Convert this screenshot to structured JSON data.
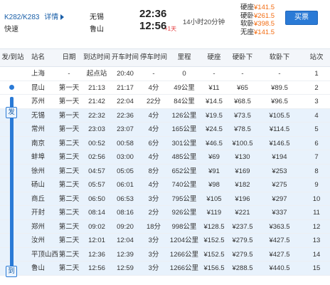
{
  "header": {
    "train_number": "K282/K283",
    "detail_link": "详情",
    "train_type": "快速",
    "from_station": "无锡",
    "to_station": "鲁山",
    "depart_time": "22:36",
    "arrive_time": "12:56",
    "next_day_mark": "+1天",
    "duration": "14小时20分钟",
    "prices": [
      {
        "name": "硬座",
        "value": "¥141.5"
      },
      {
        "name": "硬卧",
        "value": "¥261.5"
      },
      {
        "name": "软卧",
        "value": "¥398.5"
      },
      {
        "name": "无座",
        "value": "¥141.5"
      }
    ],
    "buy_label": "买票"
  },
  "table": {
    "columns": [
      "发/到站",
      "站名",
      "日期",
      "到达时间",
      "开车时间",
      "停车时间",
      "里程",
      "硬座",
      "硬卧下",
      "软卧下",
      "站次"
    ],
    "track_start": "发",
    "track_end": "到",
    "rows": [
      {
        "station": "上海",
        "date": "-",
        "arrive": "起点站",
        "depart": "20:40",
        "stop": "-",
        "mileage": "0",
        "hard_seat": "-",
        "hard_sleeper": "-",
        "soft_sleeper": "-",
        "no": "1"
      },
      {
        "station": "昆山",
        "date": "第一天",
        "arrive": "21:13",
        "depart": "21:17",
        "stop": "4分",
        "mileage": "49公里",
        "hard_seat": "¥11",
        "hard_sleeper": "¥65",
        "soft_sleeper": "¥89.5",
        "no": "2"
      },
      {
        "station": "苏州",
        "date": "第一天",
        "arrive": "21:42",
        "depart": "22:04",
        "stop": "22分",
        "mileage": "84公里",
        "hard_seat": "¥14.5",
        "hard_sleeper": "¥68.5",
        "soft_sleeper": "¥96.5",
        "no": "3"
      },
      {
        "station": "无锡",
        "date": "第一天",
        "arrive": "22:32",
        "depart": "22:36",
        "stop": "4分",
        "mileage": "126公里",
        "hard_seat": "¥19.5",
        "hard_sleeper": "¥73.5",
        "soft_sleeper": "¥105.5",
        "no": "4"
      },
      {
        "station": "常州",
        "date": "第一天",
        "arrive": "23:03",
        "depart": "23:07",
        "stop": "4分",
        "mileage": "165公里",
        "hard_seat": "¥24.5",
        "hard_sleeper": "¥78.5",
        "soft_sleeper": "¥114.5",
        "no": "5"
      },
      {
        "station": "南京",
        "date": "第二天",
        "arrive": "00:52",
        "depart": "00:58",
        "stop": "6分",
        "mileage": "301公里",
        "hard_seat": "¥46.5",
        "hard_sleeper": "¥100.5",
        "soft_sleeper": "¥146.5",
        "no": "6"
      },
      {
        "station": "蚌埠",
        "date": "第二天",
        "arrive": "02:56",
        "depart": "03:00",
        "stop": "4分",
        "mileage": "485公里",
        "hard_seat": "¥69",
        "hard_sleeper": "¥130",
        "soft_sleeper": "¥194",
        "no": "7"
      },
      {
        "station": "徐州",
        "date": "第二天",
        "arrive": "04:57",
        "depart": "05:05",
        "stop": "8分",
        "mileage": "652公里",
        "hard_seat": "¥91",
        "hard_sleeper": "¥169",
        "soft_sleeper": "¥253",
        "no": "8"
      },
      {
        "station": "砀山",
        "date": "第二天",
        "arrive": "05:57",
        "depart": "06:01",
        "stop": "4分",
        "mileage": "740公里",
        "hard_seat": "¥98",
        "hard_sleeper": "¥182",
        "soft_sleeper": "¥275",
        "no": "9"
      },
      {
        "station": "商丘",
        "date": "第二天",
        "arrive": "06:50",
        "depart": "06:53",
        "stop": "3分",
        "mileage": "795公里",
        "hard_seat": "¥105",
        "hard_sleeper": "¥196",
        "soft_sleeper": "¥297",
        "no": "10"
      },
      {
        "station": "开封",
        "date": "第二天",
        "arrive": "08:14",
        "depart": "08:16",
        "stop": "2分",
        "mileage": "926公里",
        "hard_seat": "¥119",
        "hard_sleeper": "¥221",
        "soft_sleeper": "¥337",
        "no": "11"
      },
      {
        "station": "郑州",
        "date": "第二天",
        "arrive": "09:02",
        "depart": "09:20",
        "stop": "18分",
        "mileage": "998公里",
        "hard_seat": "¥128.5",
        "hard_sleeper": "¥237.5",
        "soft_sleeper": "¥363.5",
        "no": "12"
      },
      {
        "station": "汝州",
        "date": "第二天",
        "arrive": "12:01",
        "depart": "12:04",
        "stop": "3分",
        "mileage": "1204公里",
        "hard_seat": "¥152.5",
        "hard_sleeper": "¥279.5",
        "soft_sleeper": "¥427.5",
        "no": "13"
      },
      {
        "station": "平顶山西",
        "date": "第二天",
        "arrive": "12:36",
        "depart": "12:39",
        "stop": "3分",
        "mileage": "1266公里",
        "hard_seat": "¥152.5",
        "hard_sleeper": "¥279.5",
        "soft_sleeper": "¥427.5",
        "no": "14"
      },
      {
        "station": "鲁山",
        "date": "第二天",
        "arrive": "12:56",
        "depart": "12:59",
        "stop": "3分",
        "mileage": "1266公里",
        "hard_seat": "¥156.5",
        "hard_sleeper": "¥288.5",
        "soft_sleeper": "¥440.5",
        "no": "15"
      }
    ]
  }
}
